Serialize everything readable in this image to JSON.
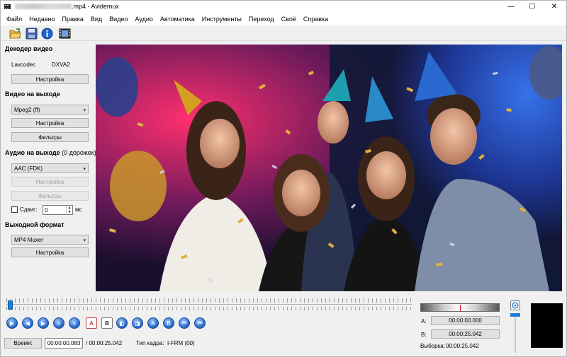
{
  "window": {
    "title_suffix": ".mp4 - Avidemux",
    "controls": [
      "—",
      "☐",
      "✕"
    ]
  },
  "menu": [
    "Файл",
    "Недавно",
    "Правка",
    "Вид",
    "Видео",
    "Аудио",
    "Автоматика",
    "Инструменты",
    "Переход",
    "Своё",
    "Справка"
  ],
  "toolbar": {
    "icons": [
      "open-icon",
      "save-icon",
      "info-icon",
      "film-icon"
    ]
  },
  "decoder": {
    "title": "Декодер видео",
    "codec": "Lavcodec",
    "hw": "DXVA2",
    "settings": "Настройка"
  },
  "video_out": {
    "title": "Видео на выходе",
    "codec": "Mpeg2 (ff)",
    "settings": "Настройка",
    "filters": "Фильтры"
  },
  "audio_out": {
    "title": "Аудио на выходе",
    "tracks": "(0 дорожек)",
    "codec": "AAC (FDK)",
    "settings": "Настройка",
    "filters": "Фильтры",
    "shift_label": "Сдвиг:",
    "shift_value": "0",
    "shift_unit": "мс"
  },
  "format": {
    "title": "Выходной формат",
    "muxer": "MP4 Muxer",
    "settings": "Настройка"
  },
  "status": {
    "time_btn": "Время:",
    "current": "00:00:00.083",
    "total": "/ 00:00:25.042",
    "frame_type_label": "Тип кадра:",
    "frame_type": "I-FRM (00)"
  },
  "selection": {
    "a_label": "A:",
    "a_value": "00:00:00.000",
    "b_label": "B:",
    "b_value": "00:00:25.042",
    "sel_label": "Выборка:",
    "sel_value": "00:00:25.042"
  },
  "playback": {
    "position_fraction": 0.003
  },
  "colors": {
    "accent": "#1e7fd6"
  }
}
